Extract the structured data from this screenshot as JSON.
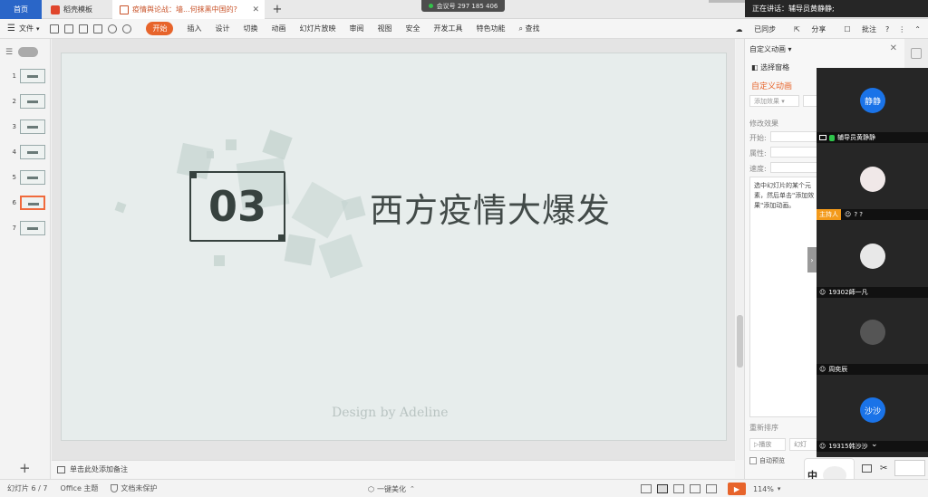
{
  "tabs": {
    "home": "首页",
    "docer": "稻壳模板",
    "document": "疫情舆论战：墙...何抹黑中国的?",
    "close": "✕",
    "add": "+"
  },
  "meeting": {
    "number_label": "会议号 297 185 406",
    "speaking": "正在讲话：辅导员黄静静;"
  },
  "menubar": {
    "file": "文件",
    "items": [
      "开始",
      "插入",
      "设计",
      "切换",
      "动画",
      "幻灯片放映",
      "审阅",
      "视图",
      "安全",
      "开发工具",
      "特色功能"
    ],
    "search": "查找",
    "sync": "已同步",
    "share": "分享",
    "comment": "批注",
    "help": "?"
  },
  "slides": {
    "numbers": [
      "1",
      "2",
      "3",
      "4",
      "5",
      "6",
      "7"
    ],
    "active_index": 6,
    "add": "+"
  },
  "slide": {
    "number": "03",
    "title": "西方疫情大爆发",
    "credit": "Design by Adeline"
  },
  "notes": {
    "placeholder": "单击此处添加备注"
  },
  "animation_panel": {
    "title": "自定义动画 ▾",
    "close": "✕",
    "selection_pane": "选择窗格",
    "section": "自定义动画",
    "add_effect": "添加效果 ▾",
    "modify_effect": "修改效果",
    "start_label": "开始:",
    "property_label": "属性:",
    "speed_label": "速度:",
    "hint": "选中幻灯片的某个元素，然后单击\"添加效果\"添加动画。",
    "reorder": "重新排序",
    "play": "播放",
    "slideshow": "幻灯",
    "auto_preview": "自动预览"
  },
  "participants": [
    {
      "avatar": "静静",
      "avatar_color": "#1a73e8",
      "name": "辅导员黄静静",
      "host": false
    },
    {
      "avatar": "",
      "avatar_color": "#f0e8e8",
      "name": "? ?",
      "host": true,
      "host_label": "主持人"
    },
    {
      "avatar": "",
      "avatar_color": "#e8e8e8",
      "name": "19302師一凡",
      "host": false
    },
    {
      "avatar": "",
      "avatar_color": "#555555",
      "name": "周奕辰",
      "host": false
    },
    {
      "avatar": "沙沙",
      "avatar_color": "#1a73e8",
      "name": "19315韩沙沙",
      "host": false
    }
  ],
  "ime": {
    "label": "中"
  },
  "statusbar": {
    "slide_info": "幻灯片 6 / 7",
    "theme": "Office 主题",
    "protect": "文档未保护",
    "beautify": "一键美化",
    "zoom": "114%"
  },
  "colors": {
    "accent": "#e7642b",
    "brand": "#2a66c8",
    "slide_bg": "#e7edec",
    "slide_text": "#37423f"
  }
}
